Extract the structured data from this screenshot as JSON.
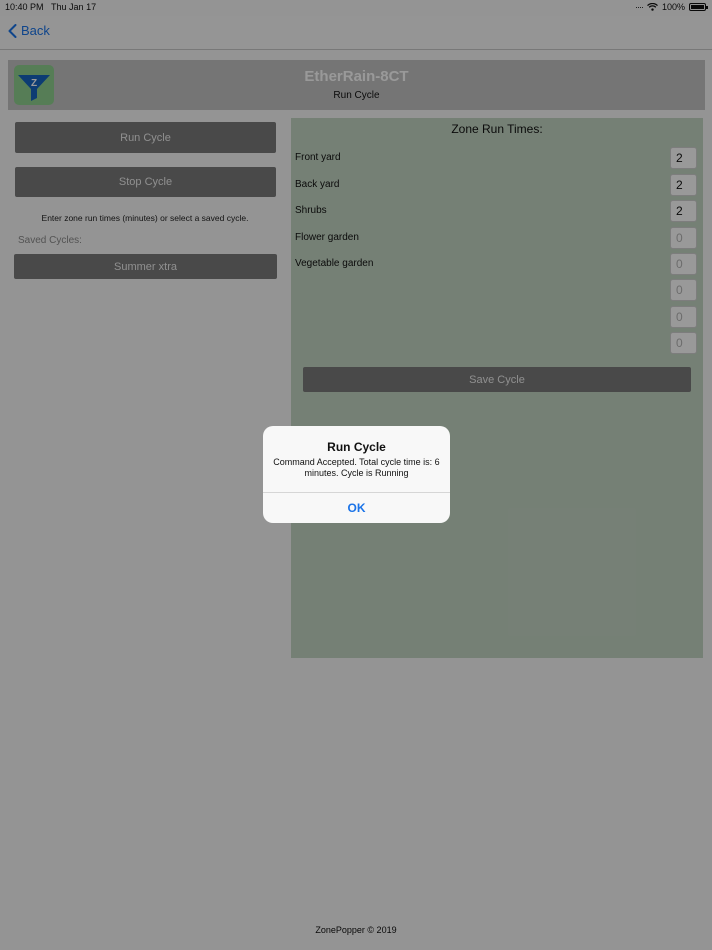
{
  "status_bar": {
    "time": "10:40 PM",
    "date": "Thu Jan 17",
    "battery": "100%"
  },
  "nav": {
    "back_label": "Back"
  },
  "header": {
    "app_title": "EtherRain-8CT",
    "subtitle": "Run Cycle",
    "logo_letter": "Z"
  },
  "actions": {
    "run_cycle": "Run Cycle",
    "stop_cycle": "Stop Cycle"
  },
  "hint": "Enter zone run times (minutes) or select a saved cycle.",
  "saved": {
    "label": "Saved Cycles:",
    "items": [
      "Summer xtra"
    ]
  },
  "zones": {
    "title": "Zone Run Times:",
    "rows": [
      {
        "label": "Front yard",
        "value": "2"
      },
      {
        "label": "Back yard",
        "value": "2"
      },
      {
        "label": "Shrubs",
        "value": "2"
      },
      {
        "label": "Flower garden",
        "placeholder": "0"
      },
      {
        "label": "Vegetable garden",
        "placeholder": "0"
      },
      {
        "label": "",
        "placeholder": "0"
      },
      {
        "label": "",
        "placeholder": "0"
      },
      {
        "label": "",
        "placeholder": "0"
      }
    ],
    "save_label": "Save Cycle"
  },
  "footer": "ZonePopper © 2019",
  "alert": {
    "title": "Run Cycle",
    "message": "Command Accepted.  Total cycle time is: 6 minutes.  Cycle is Running",
    "ok_label": "OK"
  },
  "colors": {
    "accent": "#1a73e8",
    "logo_bg": "#8fd08f",
    "logo_fg": "#1565c0",
    "zone_panel": "#c4d6c4"
  }
}
